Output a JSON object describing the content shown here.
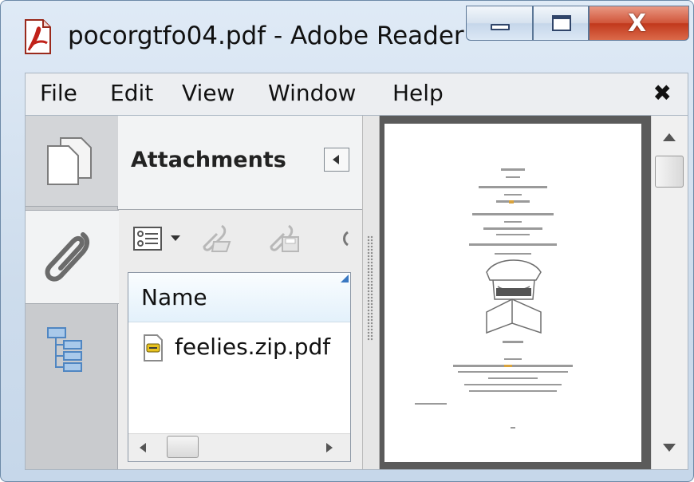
{
  "window": {
    "title": "pocorgtfo04.pdf - Adobe Reader",
    "app_icon": "pdf-document-icon",
    "controls": [
      "minimize-icon",
      "maximize-icon",
      "close-icon"
    ],
    "close_glyph": "X"
  },
  "menubar": {
    "items": [
      {
        "label": "File"
      },
      {
        "label": "Edit"
      },
      {
        "label": "View"
      },
      {
        "label": "Window"
      },
      {
        "label": "Help"
      }
    ],
    "close_glyph": "✖"
  },
  "nav_panel": {
    "tabs": [
      {
        "name": "pages",
        "icon": "pages-icon"
      },
      {
        "name": "attachments",
        "icon": "paperclip-icon",
        "selected": true
      },
      {
        "name": "bookmarks",
        "icon": "bookmarks-icon"
      }
    ]
  },
  "attachments_panel": {
    "title": "Attachments",
    "collapse_icon": "chevron-left-icon",
    "toolbar": {
      "icons": [
        "options-menu-icon",
        "dropdown-arrow-icon",
        "open-attachment-icon",
        "save-attachment-icon"
      ]
    },
    "column_header": "Name",
    "files": [
      {
        "name": "feelies.zip.pdf",
        "icon": "attachment-file-icon"
      }
    ]
  },
  "document": {
    "scrollbar_icons": [
      "scroll-up-icon",
      "scroll-down-icon"
    ]
  },
  "colors": {
    "title_bar": "#cddcec",
    "close_button": "#c94a2c",
    "menubar": "#eceef1",
    "doc_background": "#5b5b5b",
    "header_blue": "#e3f1fb",
    "bookmarks_icon": "#5a8fc8"
  }
}
